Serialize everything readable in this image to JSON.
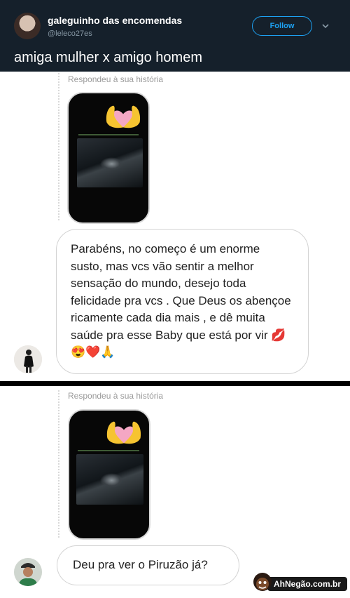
{
  "tweet": {
    "author_name": "galeguinho das encomendas",
    "author_handle": "@leleco27es",
    "follow_label": "Follow",
    "text": "amiga mulher x amigo homem"
  },
  "story_reply_1": {
    "label": "Respondeu à sua história",
    "message": "Parabéns, no começo é um enorme susto, mas vcs vão sentir a melhor sensação do mundo, desejo toda felicidade pra vcs . Que Deus os abençoe ricamente cada dia mais , e dê muita saúde pra esse Baby que está por vir 💋😍❤️🙏"
  },
  "story_reply_2": {
    "label": "Respondeu à sua história",
    "message": "Deu pra ver o Piruzão já?"
  },
  "watermark": {
    "text": "AhNegão.com.br"
  },
  "colors": {
    "header_bg": "#15202b",
    "follow_blue": "#1da1f2",
    "bubble_border": "#d3d3d3"
  }
}
